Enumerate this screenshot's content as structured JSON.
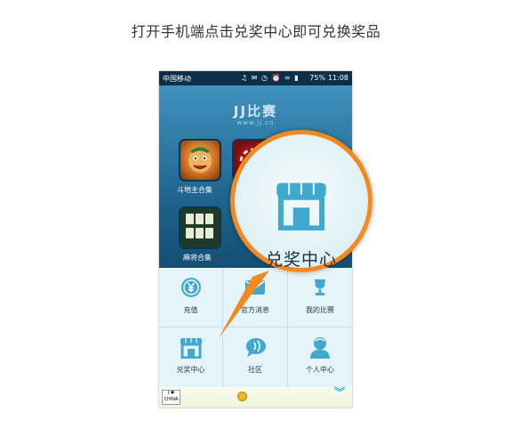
{
  "caption": "打开手机端点击兑奖中心即可兑换奖品",
  "status_bar": {
    "carrier": "中国移动",
    "icons": "♫ ✉ ◷ ⏰ ≈ ▮",
    "battery": "75%",
    "time": "11:08"
  },
  "app": {
    "brand": "JJ比赛",
    "url": "www.jj.cn"
  },
  "games": [
    {
      "label": "斗地主合集"
    },
    {
      "label": ""
    },
    {
      "label": ""
    },
    {
      "label": "麻将合集"
    }
  ],
  "menu": [
    {
      "label": "充值",
      "icon": "yuan-icon"
    },
    {
      "label": "官方消息",
      "icon": "message-icon"
    },
    {
      "label": "我的比赛",
      "icon": "trophy-icon"
    },
    {
      "label": "兑奖中心",
      "icon": "store-icon"
    },
    {
      "label": "社区",
      "icon": "chat-icon"
    },
    {
      "label": "个人中心",
      "icon": "user-icon"
    }
  ],
  "bottom_bar": {
    "badge": "I ♥ CHINA"
  },
  "magnifier": {
    "label": "兑奖中心",
    "icon": "store-icon"
  },
  "colors": {
    "accent_orange": "#f5881f",
    "menu_icon": "#3fa9cf",
    "app_blue": "#1e6d98"
  }
}
